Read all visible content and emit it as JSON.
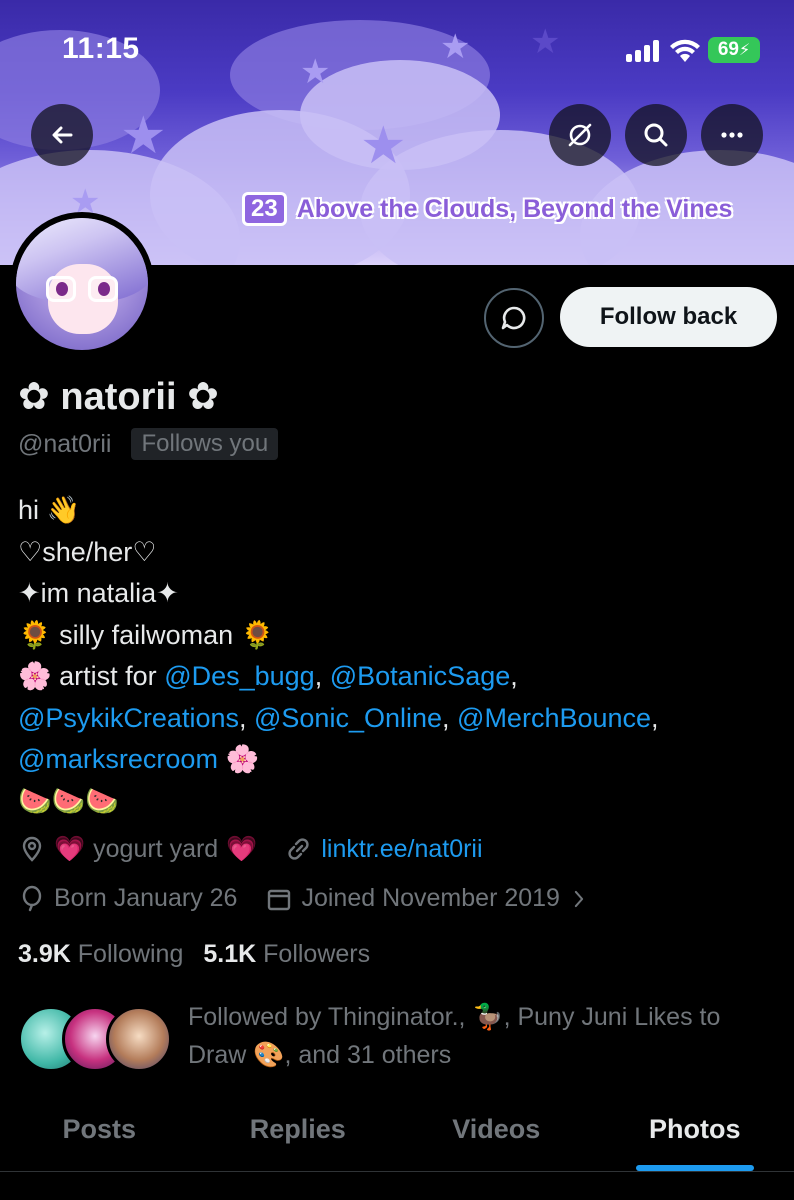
{
  "status_bar": {
    "time": "11:15",
    "battery": "69"
  },
  "banner": {
    "episode_number": "23",
    "episode_title": "Above the Clouds, Beyond the Vines"
  },
  "profile": {
    "display_name": "✿ natorii ✿",
    "handle": "@nat0rii",
    "follows_you": "Follows you",
    "follow_back_label": "Follow back"
  },
  "bio": {
    "line1": {
      "text": "hi",
      "emoji": "👋"
    },
    "line2": "♡she/her♡",
    "line3": "✦im natalia✦",
    "line4": {
      "emoji": "🌻",
      "text": "silly failwoman"
    },
    "line5": {
      "emoji": "🌸",
      "text": "artist for",
      "mention1": "@Des_bugg",
      "mention2": "@BotanicSage"
    },
    "line6": {
      "mention1": "@PsykikCreations",
      "mention2": "@Sonic_Online",
      "mention3": "@MerchBounce"
    },
    "line7": {
      "mention": "@marksrecroom",
      "emoji": "🌸"
    },
    "line8": "🍉🍉🍉"
  },
  "meta": {
    "location": "yogurt yard",
    "location_emoji": "💗",
    "website": "linktr.ee/nat0rii",
    "birthday": "Born January 26",
    "joined": "Joined November 2019"
  },
  "counts": {
    "following_count": "3.9K",
    "following_label": "Following",
    "followers_count": "5.1K",
    "followers_label": "Followers"
  },
  "followed_by": {
    "prefix": "Followed by Thinginator.,",
    "duck_emoji": "🦆",
    "middle": ", Puny Juni Likes to Draw",
    "palette_emoji": "🎨",
    "suffix": ", and 31 others"
  },
  "tabs": [
    {
      "label": "Posts"
    },
    {
      "label": "Replies"
    },
    {
      "label": "Videos"
    },
    {
      "label": "Photos"
    }
  ],
  "active_tab": "Photos",
  "colors": {
    "accent": "#1d9bf0",
    "background": "#000000",
    "muted": "#71767b"
  }
}
